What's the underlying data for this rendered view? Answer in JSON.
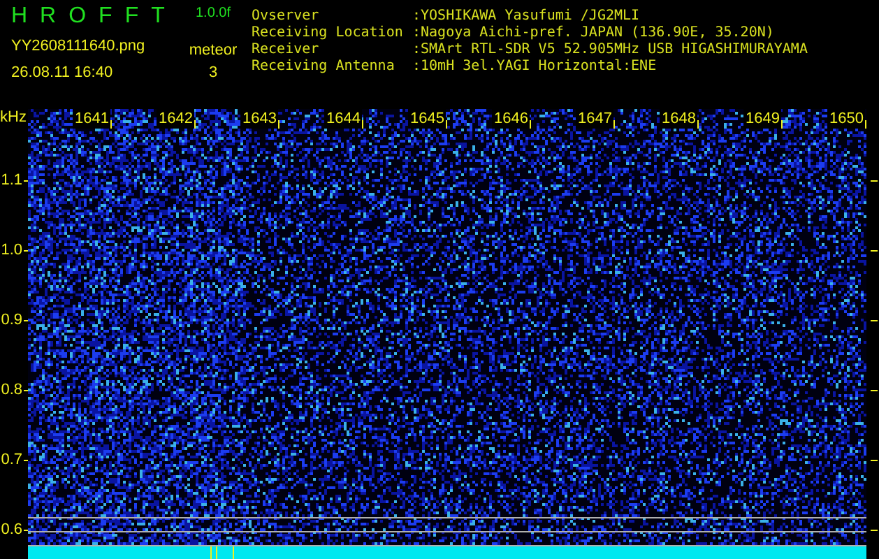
{
  "header": {
    "title": "HROFFT",
    "version": "1.0.0f",
    "filename": "YY2608111640.png",
    "datetime": "26.08.11 16:40",
    "counter_label": "meteor",
    "counter_value": "3",
    "info": [
      {
        "label": "Ovserver",
        "value": ":YOSHIKAWA Yasufumi /JG2MLI"
      },
      {
        "label": "Receiving Location",
        "value": ":Nagoya Aichi-pref. JAPAN (136.90E, 35.20N)"
      },
      {
        "label": "Receiver",
        "value": ":SMArt RTL-SDR V5 52.905MHz USB HIGASHIMURAYAMA"
      },
      {
        "label": "Receiving Antenna",
        "value": ":10mH 3el.YAGI Horizontal:ENE"
      }
    ]
  },
  "plot": {
    "y_unit": "kHz",
    "x_labels": [
      "1641",
      "1642",
      "1643",
      "1644",
      "1645",
      "1646",
      "1647",
      "1648",
      "1649",
      "1650"
    ],
    "y_labels": [
      "1.1",
      "1.0",
      "0.9",
      "0.8",
      "0.7",
      "0.6"
    ]
  }
}
